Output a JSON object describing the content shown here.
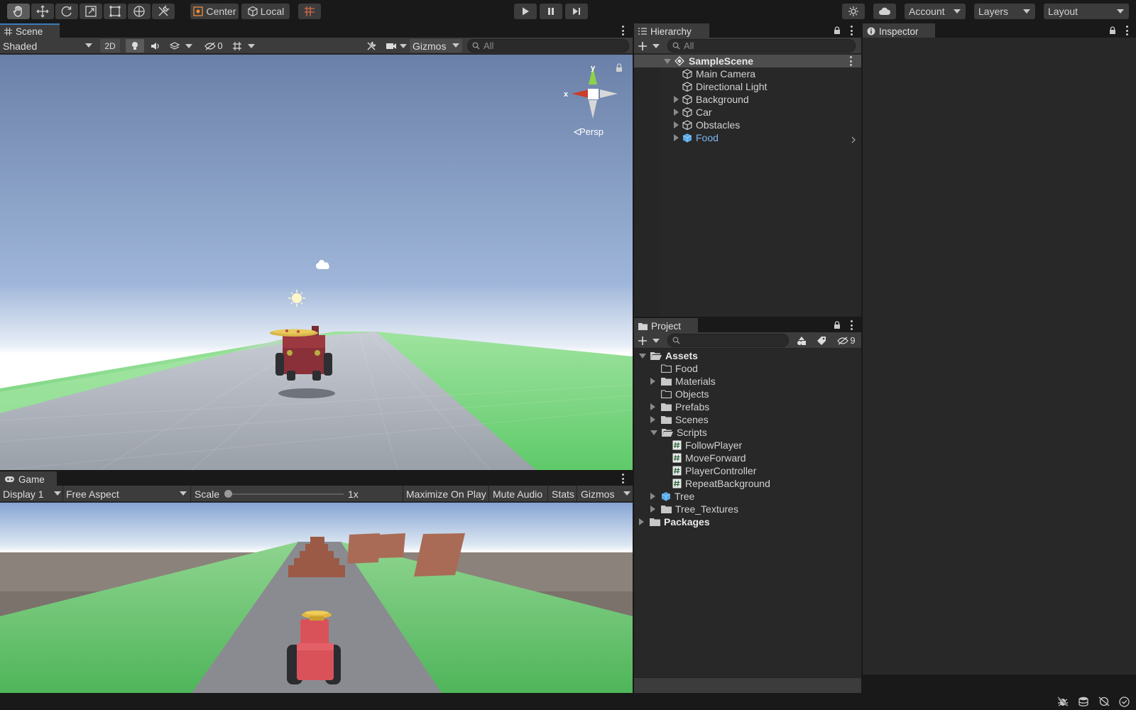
{
  "toolbar": {
    "pivot_label": "Center",
    "space_label": "Local",
    "account_label": "Account",
    "layers_label": "Layers",
    "layout_label": "Layout"
  },
  "scene": {
    "tab_label": "Scene",
    "shading_mode": "Shaded",
    "mode_2d_label": "2D",
    "hidden_count": "0",
    "gizmos_label": "Gizmos",
    "search_placeholder": "All",
    "projection_label": "Persp",
    "axis_x": "x",
    "axis_y": "y"
  },
  "game": {
    "tab_label": "Game",
    "display": "Display 1",
    "aspect": "Free Aspect",
    "scale_label": "Scale",
    "scale_value": "1x",
    "scale_level": 0.0,
    "maximize_label": "Maximize On Play",
    "mute_label": "Mute Audio",
    "stats_label": "Stats",
    "gizmos_label": "Gizmos"
  },
  "hierarchy": {
    "tab_label": "Hierarchy",
    "search_placeholder": "All",
    "scene_name": "SampleScene",
    "items": [
      {
        "label": "Main Camera",
        "expandable": false,
        "prefab": false
      },
      {
        "label": "Directional Light",
        "expandable": false,
        "prefab": false
      },
      {
        "label": "Background",
        "expandable": true,
        "prefab": false
      },
      {
        "label": "Car",
        "expandable": true,
        "prefab": false
      },
      {
        "label": "Obstacles",
        "expandable": true,
        "prefab": false
      },
      {
        "label": "Food",
        "expandable": true,
        "prefab": true
      }
    ]
  },
  "project": {
    "tab_label": "Project",
    "search_placeholder": "",
    "hidden_count": "9",
    "tree": [
      {
        "label": "Assets",
        "depth": 0,
        "state": "open",
        "bold": true,
        "icon": "folder-open"
      },
      {
        "label": "Food",
        "depth": 1,
        "state": "leaf",
        "icon": "folder-empty"
      },
      {
        "label": "Materials",
        "depth": 1,
        "state": "closed",
        "icon": "folder"
      },
      {
        "label": "Objects",
        "depth": 1,
        "state": "leaf",
        "icon": "folder-empty"
      },
      {
        "label": "Prefabs",
        "depth": 1,
        "state": "closed",
        "icon": "folder"
      },
      {
        "label": "Scenes",
        "depth": 1,
        "state": "closed",
        "icon": "folder"
      },
      {
        "label": "Scripts",
        "depth": 1,
        "state": "open",
        "icon": "folder-open"
      },
      {
        "label": "FollowPlayer",
        "depth": 2,
        "state": "leaf",
        "icon": "script"
      },
      {
        "label": "MoveForward",
        "depth": 2,
        "state": "leaf",
        "icon": "script"
      },
      {
        "label": "PlayerController",
        "depth": 2,
        "state": "leaf",
        "icon": "script"
      },
      {
        "label": "RepeatBackground",
        "depth": 2,
        "state": "leaf",
        "icon": "script"
      },
      {
        "label": "Tree",
        "depth": 1,
        "state": "closed",
        "icon": "prefab"
      },
      {
        "label": "Tree_Textures",
        "depth": 1,
        "state": "closed",
        "icon": "folder"
      },
      {
        "label": "Packages",
        "depth": 0,
        "state": "closed",
        "bold": true,
        "icon": "folder"
      }
    ]
  },
  "inspector": {
    "tab_label": "Inspector"
  },
  "colors": {
    "accent": "#3a79bb",
    "prefab_text": "#7cb4f2",
    "grass": "#5cc25c",
    "road": "#8e8f95",
    "sky_top": "#6a80a8",
    "car_red": "#d9525a"
  }
}
